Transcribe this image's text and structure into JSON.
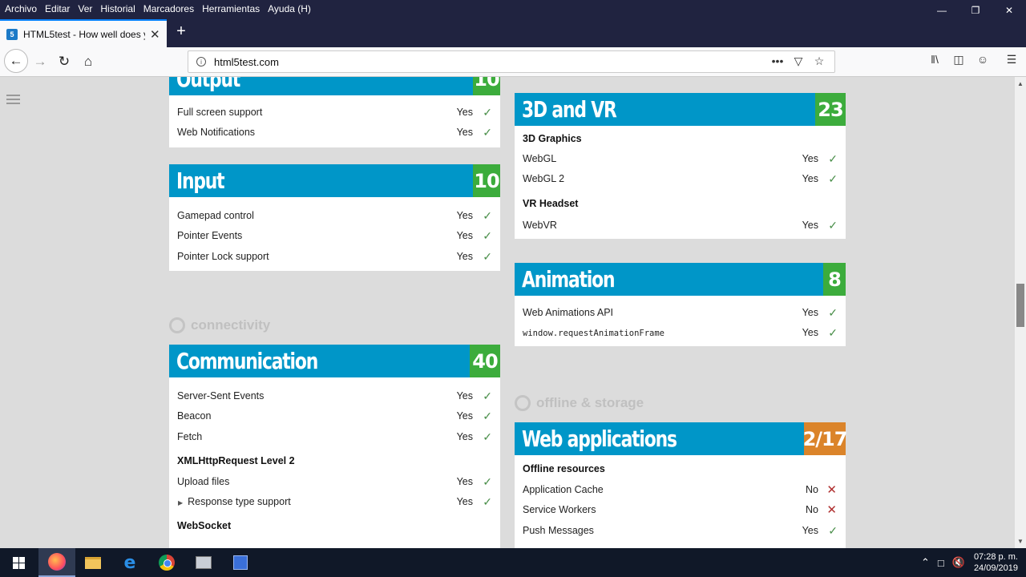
{
  "menubar": {
    "items": [
      "Archivo",
      "Editar",
      "Ver",
      "Historial",
      "Marcadores",
      "Herramientas",
      "Ayuda (H)"
    ]
  },
  "tab": {
    "title": "HTML5test - How well does yo",
    "favicon": "5"
  },
  "navbar": {
    "url": "html5test.com"
  },
  "sections": {
    "output": {
      "title": "Output",
      "score": "10",
      "rows": [
        {
          "label": "Full screen support",
          "value": "Yes"
        },
        {
          "label": "Web Notifications",
          "value": "Yes"
        }
      ]
    },
    "input": {
      "title": "Input",
      "score": "10",
      "rows": [
        {
          "label": "Gamepad control",
          "value": "Yes"
        },
        {
          "label": "Pointer Events",
          "value": "Yes"
        },
        {
          "label": "Pointer Lock support",
          "value": "Yes"
        }
      ]
    },
    "connectivity_heading": "connectivity",
    "communication": {
      "title": "Communication",
      "score": "40",
      "rows": [
        {
          "label": "Server-Sent Events",
          "value": "Yes"
        },
        {
          "label": "Beacon",
          "value": "Yes"
        },
        {
          "label": "Fetch",
          "value": "Yes"
        }
      ],
      "group_xhr": "XMLHttpRequest Level 2",
      "xhr_rows": [
        {
          "label": "Upload files",
          "value": "Yes"
        },
        {
          "label": "Response type support",
          "value": "Yes"
        }
      ],
      "group_websocket": "WebSocket"
    },
    "vr3d": {
      "title": "3D and VR",
      "score": "23",
      "group_3d": "3D Graphics",
      "rows_3d": [
        {
          "label": "WebGL",
          "value": "Yes"
        },
        {
          "label": "WebGL 2",
          "value": "Yes"
        }
      ],
      "group_vr": "VR Headset",
      "rows_vr": [
        {
          "label": "WebVR",
          "value": "Yes"
        }
      ]
    },
    "animation": {
      "title": "Animation",
      "score": "8",
      "rows": [
        {
          "label": "Web Animations API",
          "value": "Yes"
        },
        {
          "label": "window.requestAnimationFrame",
          "value": "Yes"
        }
      ]
    },
    "offline_heading": "offline & storage",
    "webapps": {
      "title": "Web applications",
      "score": "2/17",
      "group_offline": "Offline resources",
      "rows": [
        {
          "label": "Application Cache",
          "value": "No"
        },
        {
          "label": "Service Workers",
          "value": "No"
        },
        {
          "label": "Push Messages",
          "value": "Yes"
        }
      ]
    }
  },
  "taskbar": {
    "time": "07:28 p. m.",
    "date": "24/09/2019"
  },
  "colors": {
    "section_header": "#0096c8",
    "score_green": "#3cac3c",
    "score_orange": "#db842a"
  }
}
